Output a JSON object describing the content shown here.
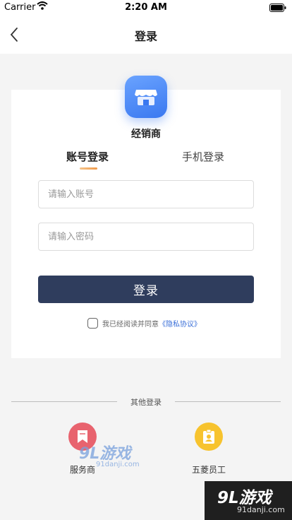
{
  "status_bar": {
    "carrier": "Carrier",
    "time": "2:20 AM"
  },
  "nav": {
    "title": "登录"
  },
  "card": {
    "app_name": "经销商",
    "tabs": [
      {
        "label": "账号登录",
        "active": true
      },
      {
        "label": "手机登录",
        "active": false
      }
    ],
    "account_placeholder": "请输入账号",
    "password_placeholder": "请输入密码",
    "login_label": "登录",
    "agree_text": "我已经阅读并同意",
    "privacy_link": "《隐私协议》"
  },
  "other_login": {
    "title": "其他登录",
    "options": [
      {
        "label": "服务商",
        "icon": "bookmark-icon",
        "color": "#e8636e"
      },
      {
        "label": "五菱员工",
        "icon": "badge-icon",
        "color": "#f7c32e"
      }
    ]
  },
  "watermark": {
    "logo_text": "9L游戏",
    "domain": "91danji.com"
  },
  "colors": {
    "primary_button": "#2f3d5d",
    "link": "#3a6fd8",
    "logo_blue": "#3a78f0",
    "tab_indicator": "#f09a4a"
  }
}
